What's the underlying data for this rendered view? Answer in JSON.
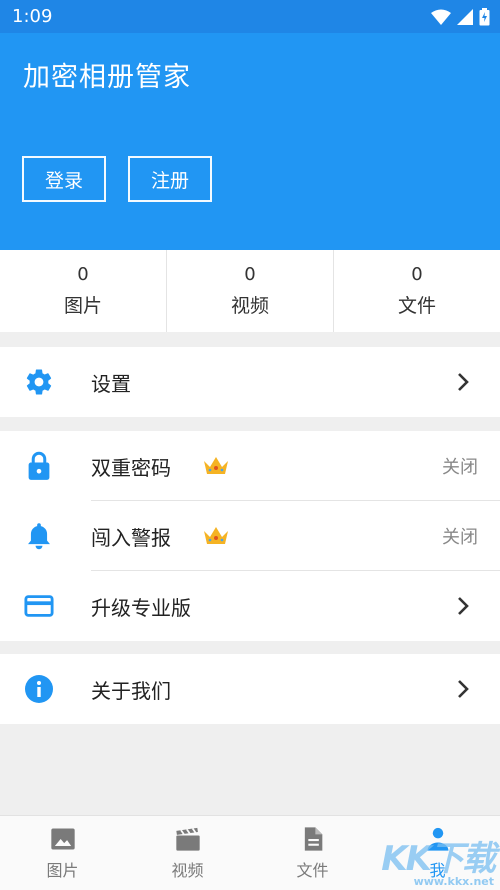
{
  "status_bar": {
    "time": "1:09"
  },
  "header": {
    "title": "加密相册管家",
    "login_label": "登录",
    "register_label": "注册",
    "bg_color": "#2196f3"
  },
  "stats": [
    {
      "count": "0",
      "label": "图片"
    },
    {
      "count": "0",
      "label": "视频"
    },
    {
      "count": "0",
      "label": "文件"
    }
  ],
  "menu": {
    "settings": {
      "label": "设置",
      "icon": "gear-icon"
    },
    "double_password": {
      "label": "双重密码",
      "value": "关闭",
      "icon": "lock-icon",
      "badge": "crown-icon"
    },
    "intrusion_alert": {
      "label": "闯入警报",
      "value": "关闭",
      "icon": "bell-icon",
      "badge": "crown-icon"
    },
    "upgrade": {
      "label": "升级专业版",
      "icon": "card-icon"
    },
    "about": {
      "label": "关于我们",
      "icon": "info-icon"
    }
  },
  "tabbar": {
    "items": [
      {
        "label": "图片",
        "icon": "image-icon"
      },
      {
        "label": "视频",
        "icon": "clapperboard-icon"
      },
      {
        "label": "文件",
        "icon": "document-icon"
      },
      {
        "label": "我",
        "icon": "person-icon",
        "active": true
      }
    ],
    "active_color": "#2196f3"
  },
  "watermark": {
    "brand": "KK下载",
    "url": "www.kkx.net"
  }
}
